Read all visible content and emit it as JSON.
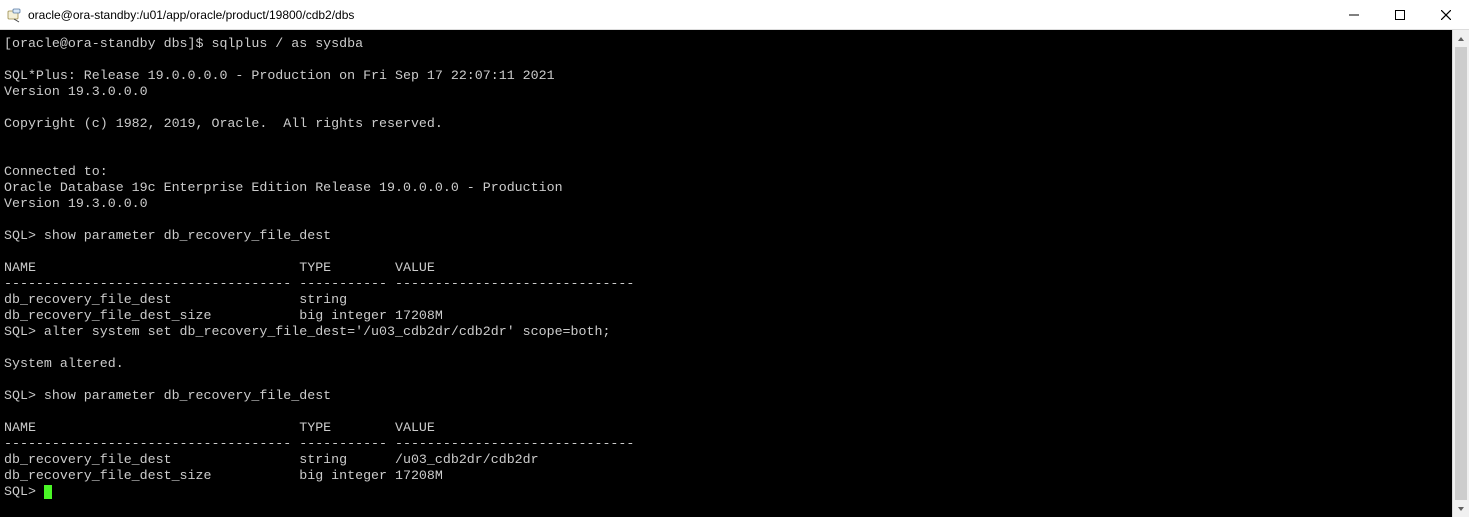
{
  "window": {
    "title": "oracle@ora-standby:/u01/app/oracle/product/19800/cdb2/dbs"
  },
  "terminal": {
    "lines": [
      "[oracle@ora-standby dbs]$ sqlplus / as sysdba",
      "",
      "SQL*Plus: Release 19.0.0.0.0 - Production on Fri Sep 17 22:07:11 2021",
      "Version 19.3.0.0.0",
      "",
      "Copyright (c) 1982, 2019, Oracle.  All rights reserved.",
      "",
      "",
      "Connected to:",
      "Oracle Database 19c Enterprise Edition Release 19.0.0.0.0 - Production",
      "Version 19.3.0.0.0",
      "",
      "SQL> show parameter db_recovery_file_dest",
      "",
      "NAME                                 TYPE        VALUE",
      "------------------------------------ ----------- ------------------------------",
      "db_recovery_file_dest                string",
      "db_recovery_file_dest_size           big integer 17208M",
      "SQL> alter system set db_recovery_file_dest='/u03_cdb2dr/cdb2dr' scope=both;",
      "",
      "System altered.",
      "",
      "SQL> show parameter db_recovery_file_dest",
      "",
      "NAME                                 TYPE        VALUE",
      "------------------------------------ ----------- ------------------------------",
      "db_recovery_file_dest                string      /u03_cdb2dr/cdb2dr",
      "db_recovery_file_dest_size           big integer 17208M"
    ],
    "prompt": "SQL> "
  }
}
